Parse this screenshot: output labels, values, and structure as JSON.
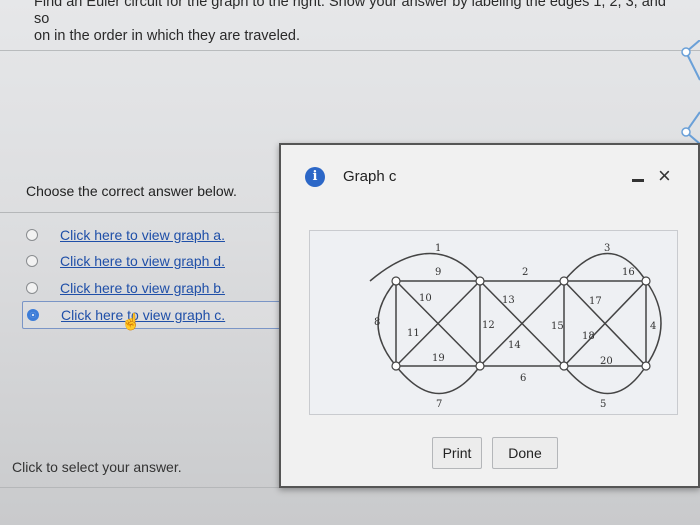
{
  "question": {
    "line1": "Find an Euler circuit for the graph to the right. Show your answer by labeling the edges 1, 2, 3, and so",
    "line2": "on in the order in which they are traveled."
  },
  "choose_prompt": "Choose the correct answer below.",
  "options": [
    {
      "label": "Click here to view graph a.",
      "selected": false
    },
    {
      "label": "Click here to view graph d.",
      "selected": false
    },
    {
      "label": "Click here to view graph b.",
      "selected": false
    },
    {
      "label": "Click here to view graph c.",
      "selected": true
    }
  ],
  "hint": "Click to select your answer.",
  "modal": {
    "title": "Graph c",
    "info_icon": "i",
    "close_icon": "×",
    "print_label": "Print",
    "done_label": "Done"
  },
  "graph": {
    "edge_labels": [
      "1",
      "2",
      "3",
      "4",
      "5",
      "6",
      "7",
      "8",
      "9",
      "10",
      "11",
      "12",
      "13",
      "14",
      "15",
      "16",
      "17",
      "18",
      "19",
      "20"
    ]
  },
  "colors": {
    "link": "#1f4fa8",
    "radio_selected": "#3d7dd8",
    "info_icon_bg": "#2c67c7"
  }
}
